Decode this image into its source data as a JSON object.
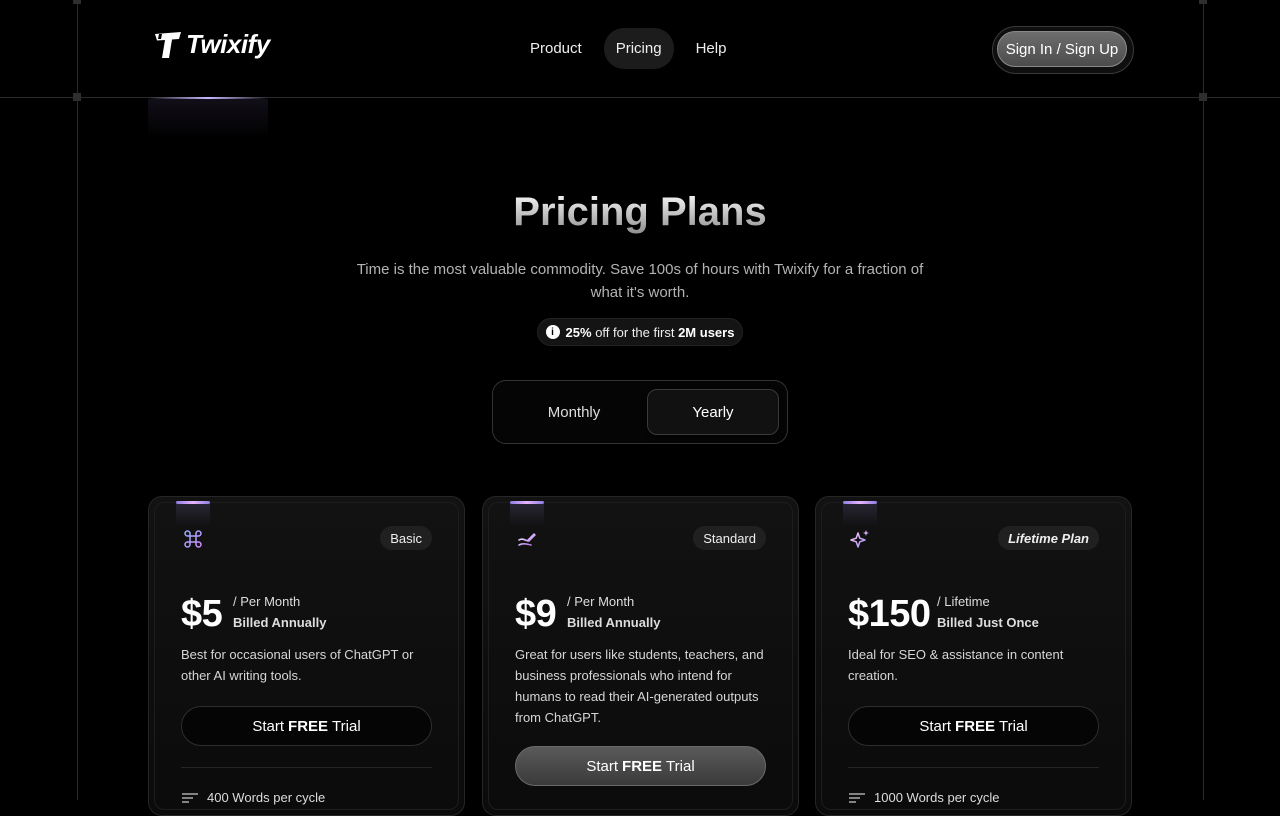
{
  "brand": {
    "name": "Twixify"
  },
  "nav": {
    "links": [
      "Product",
      "Pricing",
      "Help"
    ],
    "active": "Pricing",
    "signin_label": "Sign In / Sign Up"
  },
  "hero": {
    "title": "Pricing Plans",
    "subtitle": "Time is the most valuable commodity. Save 100s of hours with Twixify for a fraction of what it's worth.",
    "promo": {
      "discount": "25%",
      "middle": "off for the first",
      "users": "2M users"
    }
  },
  "billing_toggle": {
    "monthly": "Monthly",
    "yearly": "Yearly",
    "selected": "Yearly"
  },
  "plans": [
    {
      "icon": "command-icon",
      "badge": "Basic",
      "price": "$5",
      "period": "/ Per Month",
      "billing": "Billed Annually",
      "description": "Best for occasional users of ChatGPT or other AI writing tools.",
      "cta_pre": "Start",
      "cta_bold": "FREE",
      "cta_post": "Trial",
      "feature": "400 Words per cycle"
    },
    {
      "icon": "pen-icon",
      "badge": "Standard",
      "price": "$9",
      "period": "/ Per Month",
      "billing": "Billed Annually",
      "description": "Great for users like students, teachers, and business professionals who intend for humans to read their AI-generated outputs from ChatGPT.",
      "cta_pre": "Start",
      "cta_bold": "FREE",
      "cta_post": "Trial",
      "feature": ""
    },
    {
      "icon": "sparkles-icon",
      "badge": "Lifetime Plan",
      "price": "$150",
      "period": "/ Lifetime",
      "billing": "Billed Just Once",
      "description": "Ideal for SEO & assistance in content creation.",
      "cta_pre": "Start",
      "cta_bold": "FREE",
      "cta_post": "Trial",
      "feature": "1000 Words per cycle"
    }
  ],
  "colors": {
    "background": "#000000",
    "accent_glow": "#c7b8ff",
    "icon_gradient": "#b48cff"
  }
}
